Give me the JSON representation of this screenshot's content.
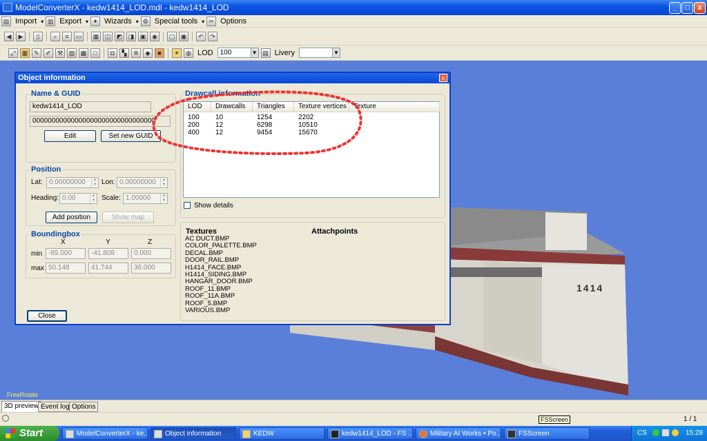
{
  "window": {
    "title": "ModelConverterX - kedw1414_LOD.mdl - kedw1414_LOD",
    "min": "_",
    "max": "□",
    "close": "x"
  },
  "menu": {
    "import": "Import",
    "export": "Export",
    "wizards": "Wizards",
    "special_tools": "Special tools",
    "options": "Options"
  },
  "toolbar2": {
    "lod_label": "LOD",
    "lod_value": "100",
    "livery_label": "Livery",
    "livery_value": ""
  },
  "dialog": {
    "title": "Object information",
    "close": "x",
    "name_guid": {
      "label": "Name & GUID",
      "name": "kedw1414_LOD",
      "guid": "00000000000000000000000000000000",
      "edit": "Edit",
      "set_guid": "Set new GUID"
    },
    "position": {
      "label": "Position",
      "lat_label": "Lat:",
      "lat": "0.00000000",
      "lon_label": "Lon:",
      "lon": "0.00000000",
      "heading_label": "Heading:",
      "heading": "0.00",
      "scale_label": "Scale:",
      "scale": "1.00000",
      "add_position": "Add position",
      "show_map": "Show map"
    },
    "bbox": {
      "label": "Boundingbox",
      "x": "X",
      "y": "Y",
      "z": "Z",
      "min_label": "min",
      "max_label": "max",
      "min": [
        "-85.000",
        "-41.808",
        "0.000"
      ],
      "max": [
        "50.148",
        "41.744",
        "36.000"
      ]
    },
    "drawcall": {
      "label": "Drawcall information",
      "columns": [
        "LOD",
        "Drawcalls",
        "Triangles",
        "Texture vertices",
        "Texture"
      ],
      "rows": [
        [
          "100",
          "10",
          "1254",
          "2202",
          ""
        ],
        [
          "200",
          "12",
          "6298",
          "10510",
          ""
        ],
        [
          "400",
          "12",
          "9454",
          "15670",
          ""
        ]
      ],
      "show_details": "Show details"
    },
    "textures": {
      "label": "Textures",
      "items": [
        "AC DUCT.BMP",
        "COLOR_PALETTE.BMP",
        "DECAL.BMP",
        "DOOR_RAIL.BMP",
        "H1414_FACE.BMP",
        "H1414_SIDING.BMP",
        "HANGAR_DOOR.BMP",
        "ROOF_11.BMP",
        "ROOF_11A.BMP",
        "ROOF_5.BMP",
        "VARIOUS.BMP"
      ]
    },
    "attachpoints": {
      "label": "Attachpoints"
    },
    "close_button": "Close"
  },
  "viewport": {
    "building_number": "1414",
    "mode": "FreeRotate"
  },
  "tabs": [
    "3D preview",
    "Event log",
    "Options"
  ],
  "status": {
    "tooltip": "FSScreen",
    "page": "1 / 1"
  },
  "taskbar": {
    "start": "Start",
    "tasks": [
      "ModelConverterX - ke...",
      "Object information",
      "KEDW",
      "kedw1414_LOD - FS ...",
      "Military AI Works • Po...",
      "FSScreen"
    ],
    "lang": "CS",
    "clock": "15:28"
  }
}
